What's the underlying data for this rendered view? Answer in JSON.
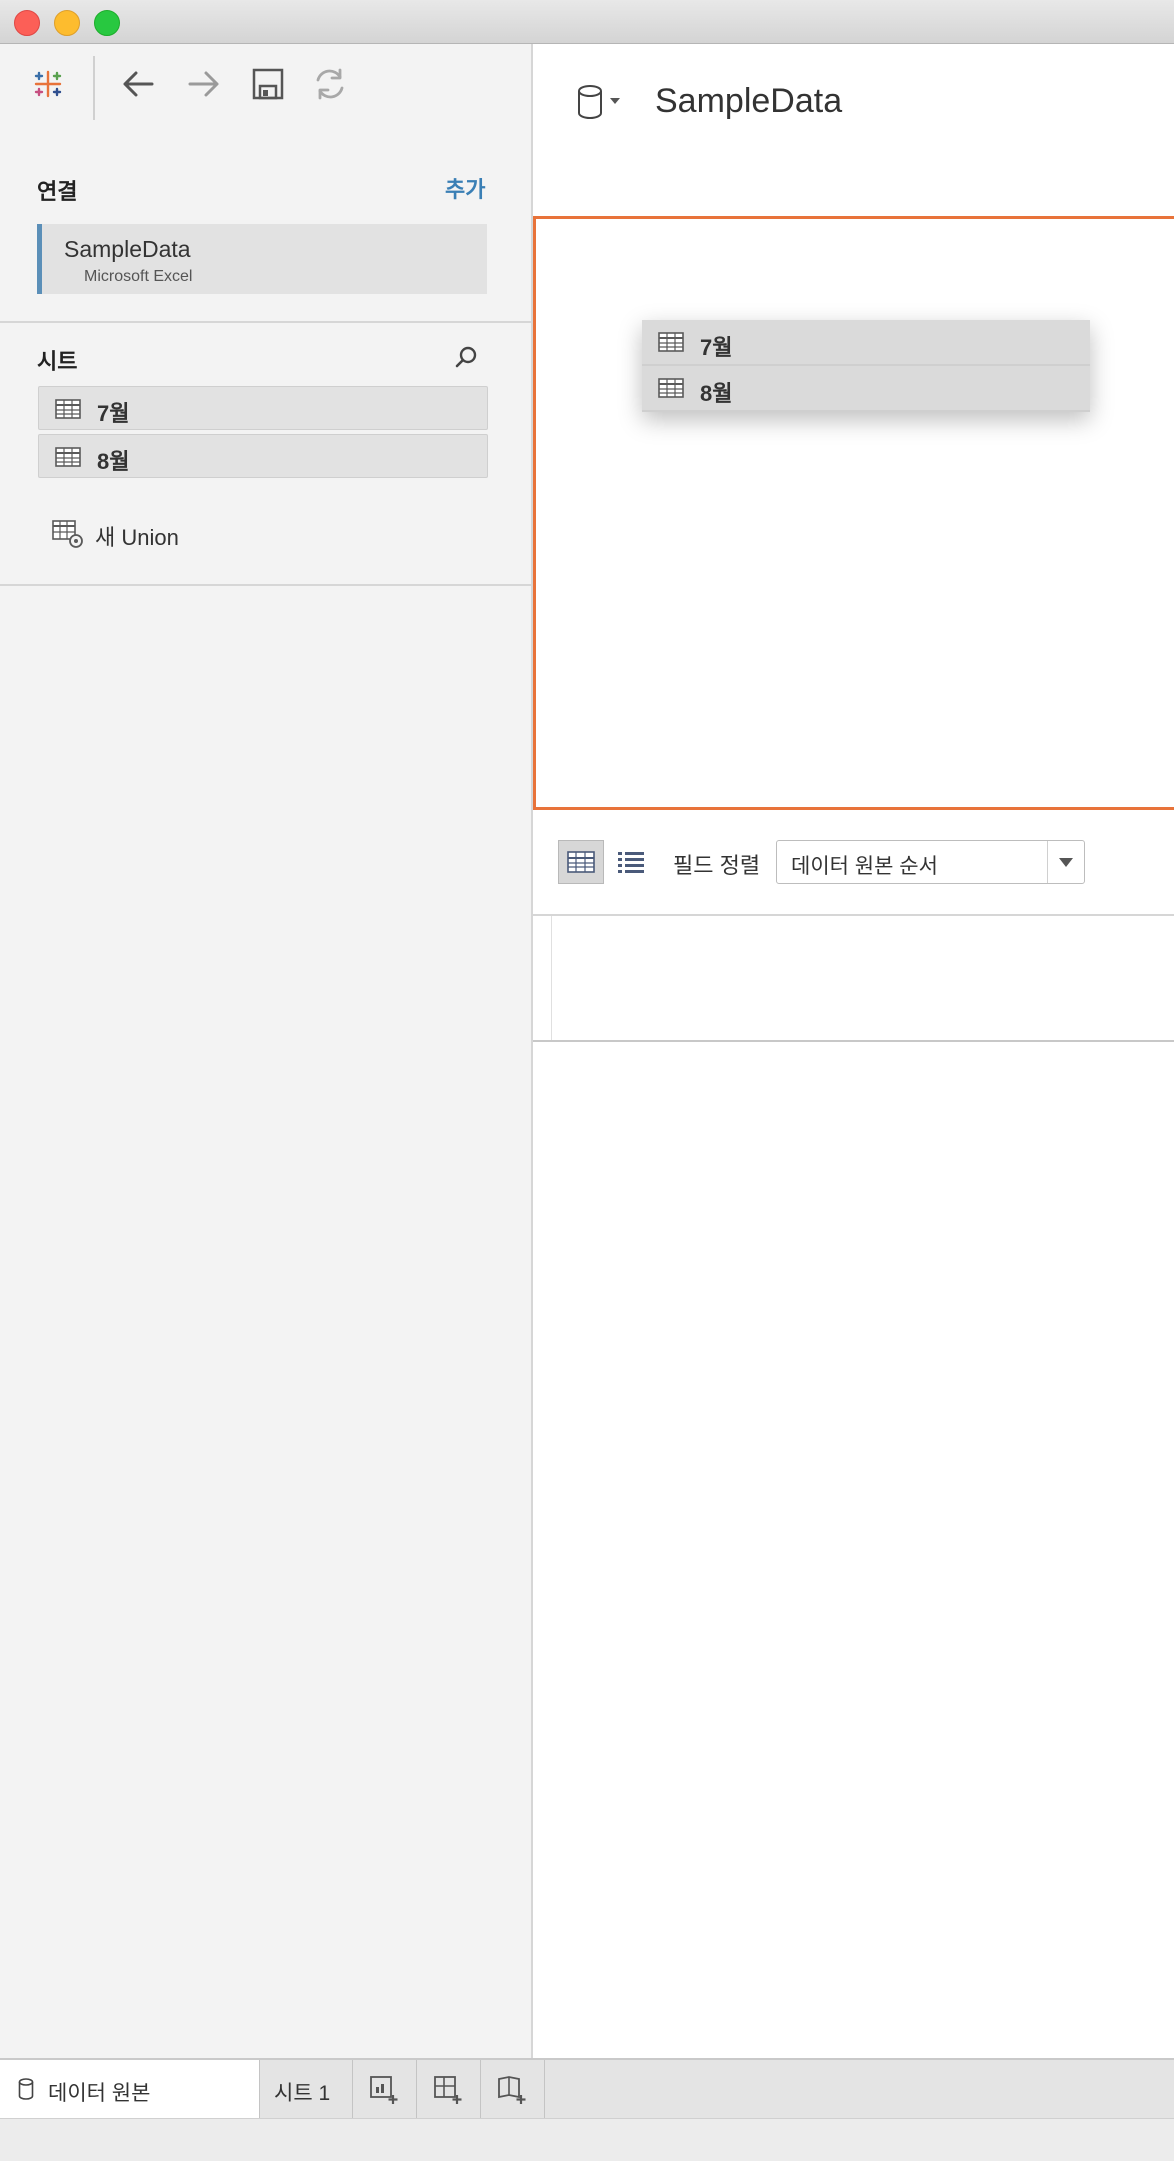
{
  "app": {
    "colors": {
      "accent": "#e8733a",
      "link": "#3a7fb5",
      "connection_bar": "#5b8fb8"
    }
  },
  "toolbar": {
    "icons": [
      "tableau-logo-icon",
      "back-arrow-icon",
      "forward-arrow-icon",
      "save-icon",
      "refresh-icon"
    ]
  },
  "sidebar": {
    "connections_title": "연결",
    "add_label": "추가",
    "connection": {
      "name": "SampleData",
      "type": "Microsoft Excel"
    },
    "sheets_title": "시트",
    "sheets": [
      {
        "label": "7월"
      },
      {
        "label": "8월"
      }
    ],
    "new_union_label": "새 Union"
  },
  "main": {
    "datasource_title": "SampleData",
    "dragged_items": [
      {
        "label": "7월"
      },
      {
        "label": "8월"
      }
    ],
    "sort_label": "필드 정렬",
    "sort_value": "데이터 원본 순서"
  },
  "tabs": {
    "datasource_label": "데이터 원본",
    "sheet1_label": "시트 1"
  }
}
